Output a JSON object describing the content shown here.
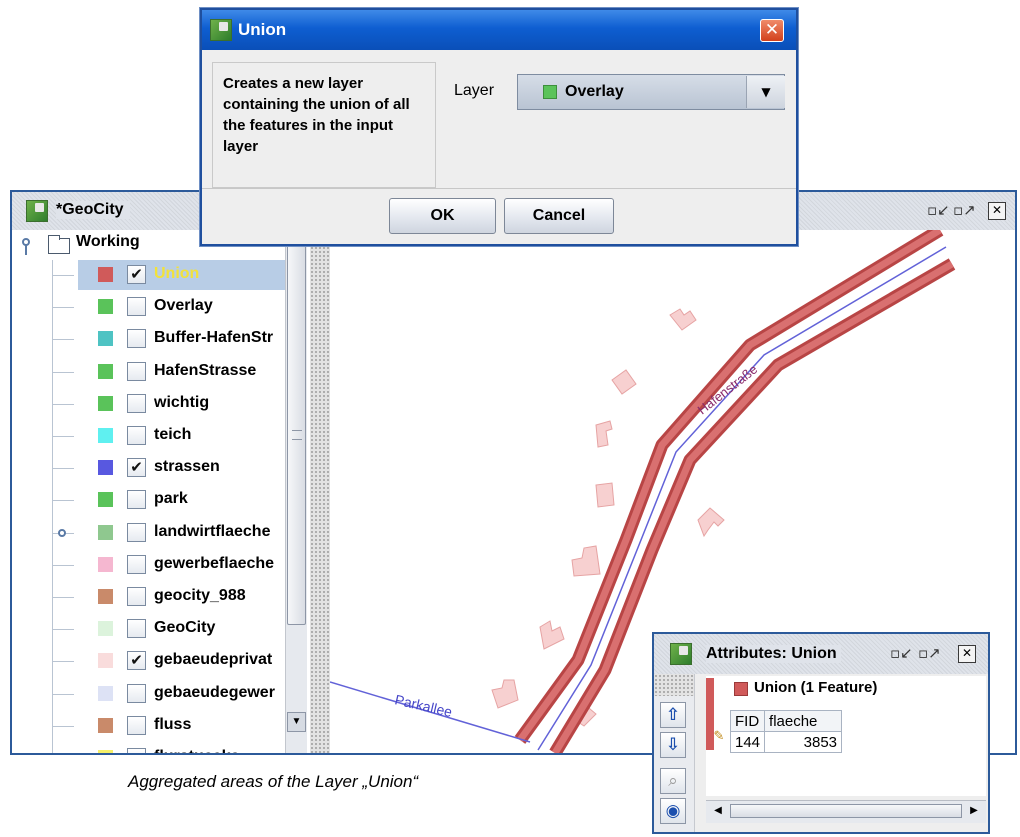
{
  "main_window": {
    "title": "*GeoCity",
    "controls": [
      "minimize-icon",
      "maximize-icon",
      "close-icon"
    ]
  },
  "layer_tree": {
    "root_label": "Working",
    "layers": [
      {
        "name": "Union",
        "color": "#d05a5a",
        "checked": true,
        "selected": true,
        "label_color": "#f2e23a"
      },
      {
        "name": "Overlay",
        "color": "#5ac35a",
        "checked": false
      },
      {
        "name": "Buffer-HafenStr",
        "color": "#4ec3c3",
        "checked": false
      },
      {
        "name": "HafenStrasse",
        "color": "#5ac35a",
        "checked": false
      },
      {
        "name": "wichtig",
        "color": "#5ac35a",
        "checked": false
      },
      {
        "name": "teich",
        "color": "#5ff0f0",
        "checked": false
      },
      {
        "name": "strassen",
        "color": "#5858e0",
        "checked": true
      },
      {
        "name": "park",
        "color": "#5ac35a",
        "checked": false
      },
      {
        "name": "landwirtflaeche",
        "color": "#8fc88f",
        "checked": false,
        "expandable": true
      },
      {
        "name": "gewerbeflaeche",
        "color": "#f5b7d0",
        "checked": false
      },
      {
        "name": "geocity_988",
        "color": "#c98a6a",
        "checked": false
      },
      {
        "name": "GeoCity",
        "color": "#dcf3dc",
        "checked": false
      },
      {
        "name": "gebaeudeprivat",
        "color": "#f9dcdc",
        "checked": true
      },
      {
        "name": "gebaeudegewer",
        "color": "#dde2f5",
        "checked": false
      },
      {
        "name": "fluss",
        "color": "#c98a6a",
        "checked": false
      },
      {
        "name": "flurstuecke",
        "color": "#f5f06a",
        "checked": false
      }
    ]
  },
  "map": {
    "street_labels": [
      "Hafenstraße",
      "Parkallee"
    ],
    "colors": {
      "union": "#d05a5a",
      "buildings": "#f7d0d0",
      "street_line": "#5858e0"
    }
  },
  "union_dialog": {
    "title": "Union",
    "description": "Creates a new layer containing the union of all the features in the input layer",
    "layer_label": "Layer",
    "layer_value": "Overlay",
    "ok_label": "OK",
    "cancel_label": "Cancel"
  },
  "attributes_window": {
    "title": "Attributes: Union",
    "group_label": "Union (1 Feature)",
    "columns": [
      "FID",
      "flaeche"
    ],
    "rows": [
      {
        "FID": "144",
        "flaeche": "3853"
      }
    ]
  },
  "caption": "Aggregated areas of the  Layer „Union“"
}
